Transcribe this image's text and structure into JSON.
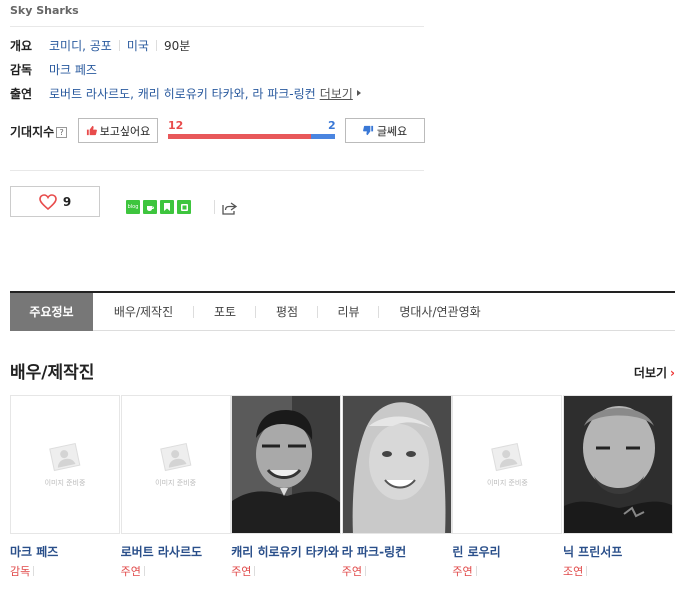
{
  "movie": {
    "eng_title": "Sky Sharks"
  },
  "info": {
    "overview_label": "개요",
    "genre": "코미디, 공포",
    "country": "미국",
    "runtime": "90분",
    "director_label": "감독",
    "director": "마크 페즈",
    "cast_label": "출연",
    "cast_list": "로버트 라사르도, 캐리 히로유키 타카와, 라 파크-링컨",
    "more": "더보기"
  },
  "expectation": {
    "label": "기대지수",
    "help": "?",
    "want_label": "보고싶어요",
    "nah_label": "글쎄요",
    "want_count": "12",
    "nah_count": "2",
    "want_ratio": 0.857
  },
  "like": {
    "count": "9"
  },
  "share": {
    "icons": [
      "blog-icon",
      "cafe-icon",
      "bookmark-icon",
      "band-icon"
    ]
  },
  "tabs": [
    "주요정보",
    "배우/제작진",
    "포토",
    "평점",
    "리뷰",
    "명대사/연관영화"
  ],
  "section": {
    "title": "배우/제작진",
    "more": "더보기"
  },
  "noimage_text": "이미지 준비중",
  "people": [
    {
      "name": "마크 페즈",
      "role": "감독",
      "photo": "none"
    },
    {
      "name": "로버트 라사르도",
      "role": "주연",
      "photo": "none"
    },
    {
      "name": "캐리 히로유키 타카와",
      "role": "주연",
      "photo": "man-laughing"
    },
    {
      "name": "라 파크-링컨",
      "role": "주연",
      "photo": "woman-smiling"
    },
    {
      "name": "린 로우리",
      "role": "주연",
      "photo": "none"
    },
    {
      "name": "닉 프린서프",
      "role": "조연",
      "photo": "bald-man"
    }
  ],
  "colors": {
    "accent_red": "#e84c4c",
    "accent_blue": "#3a78d6",
    "link": "#2a5a9e",
    "tab_active": "#777777",
    "share_green": "#3ec53e"
  }
}
